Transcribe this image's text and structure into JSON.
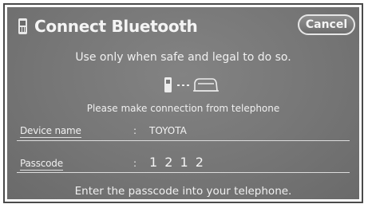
{
  "header": {
    "icon": "bluetooth-phone-icon",
    "title": "Connect Bluetooth",
    "cancel_label": "Cancel"
  },
  "messages": {
    "safety": "Use only when safe and legal to do so.",
    "instruction": "Please make connection from telephone",
    "footer": "Enter the passcode into your telephone."
  },
  "connection_icon": "phone-to-car-connection-icon",
  "device": {
    "label": "Device name",
    "separator": ":",
    "value": "TOYOTA"
  },
  "passcode": {
    "label": "Passcode",
    "separator": ":",
    "value": "1 2 1 2"
  },
  "colors": {
    "screen": "#777777",
    "text": "#f2f2f2",
    "frame": "#4a4a4a"
  }
}
